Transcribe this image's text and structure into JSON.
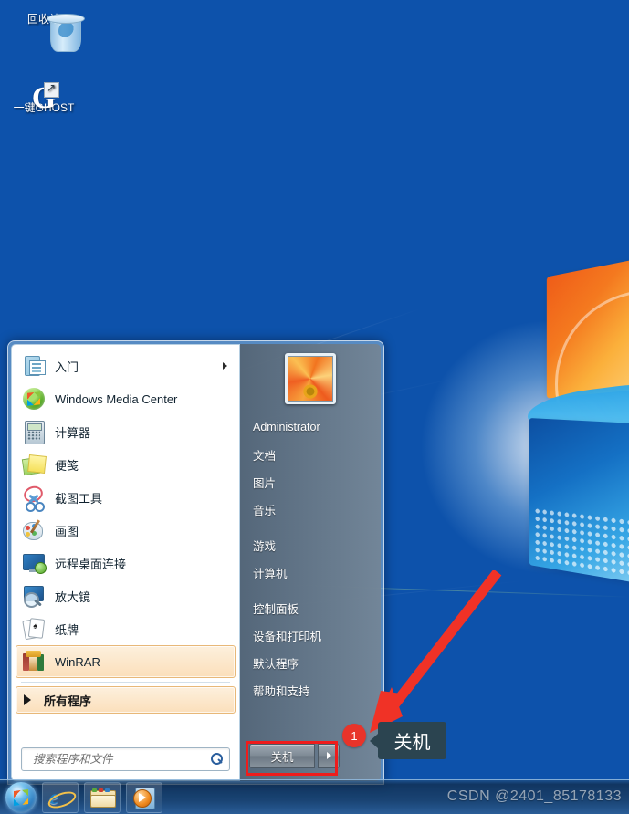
{
  "desktop": {
    "icons": [
      {
        "label": "回收站",
        "icon": "recycle-bin-icon"
      },
      {
        "label": "一键GHOST",
        "icon": "ghost-app-icon"
      }
    ]
  },
  "start_menu": {
    "programs": [
      {
        "label": "入门",
        "icon": "getting-started-icon",
        "has_submenu": true,
        "selected": false
      },
      {
        "label": "Windows Media Center",
        "icon": "windows-media-center-icon",
        "has_submenu": false,
        "selected": false
      },
      {
        "label": "计算器",
        "icon": "calculator-icon",
        "has_submenu": false,
        "selected": false
      },
      {
        "label": "便笺",
        "icon": "sticky-notes-icon",
        "has_submenu": false,
        "selected": false
      },
      {
        "label": "截图工具",
        "icon": "snipping-tool-icon",
        "has_submenu": false,
        "selected": false
      },
      {
        "label": "画图",
        "icon": "paint-icon",
        "has_submenu": false,
        "selected": false
      },
      {
        "label": "远程桌面连接",
        "icon": "remote-desktop-icon",
        "has_submenu": false,
        "selected": false
      },
      {
        "label": "放大镜",
        "icon": "magnifier-icon",
        "has_submenu": false,
        "selected": false
      },
      {
        "label": "纸牌",
        "icon": "solitaire-icon",
        "has_submenu": false,
        "selected": false
      },
      {
        "label": "WinRAR",
        "icon": "winrar-icon",
        "has_submenu": false,
        "selected": true
      }
    ],
    "all_programs_label": "所有程序",
    "search": {
      "placeholder": "搜索程序和文件",
      "value": "",
      "icon": "search-icon"
    },
    "user": {
      "name": "Administrator",
      "avatar": "user-avatar-flower"
    },
    "places": [
      {
        "label": "文档",
        "divider_after": false
      },
      {
        "label": "图片",
        "divider_after": false
      },
      {
        "label": "音乐",
        "divider_after": true
      },
      {
        "label": "游戏",
        "divider_after": false
      },
      {
        "label": "计算机",
        "divider_after": true
      },
      {
        "label": "控制面板",
        "divider_after": false
      },
      {
        "label": "设备和打印机",
        "divider_after": false
      },
      {
        "label": "默认程序",
        "divider_after": false
      },
      {
        "label": "帮助和支持",
        "divider_after": false
      }
    ],
    "shutdown": {
      "label": "关机",
      "options_icon": "chevron-right-icon"
    }
  },
  "annotation": {
    "step_number": "1",
    "callout_text": "关机",
    "highlight_color": "#ee1c1c",
    "badge_color": "#e8342a",
    "callout_bg": "#2b4450"
  },
  "taskbar": {
    "items": [
      {
        "name": "start-orb",
        "label": ""
      },
      {
        "name": "internet-explorer",
        "label": ""
      },
      {
        "name": "windows-explorer",
        "label": ""
      },
      {
        "name": "windows-media-player",
        "label": ""
      }
    ]
  },
  "watermark": "CSDN @2401_85178133"
}
